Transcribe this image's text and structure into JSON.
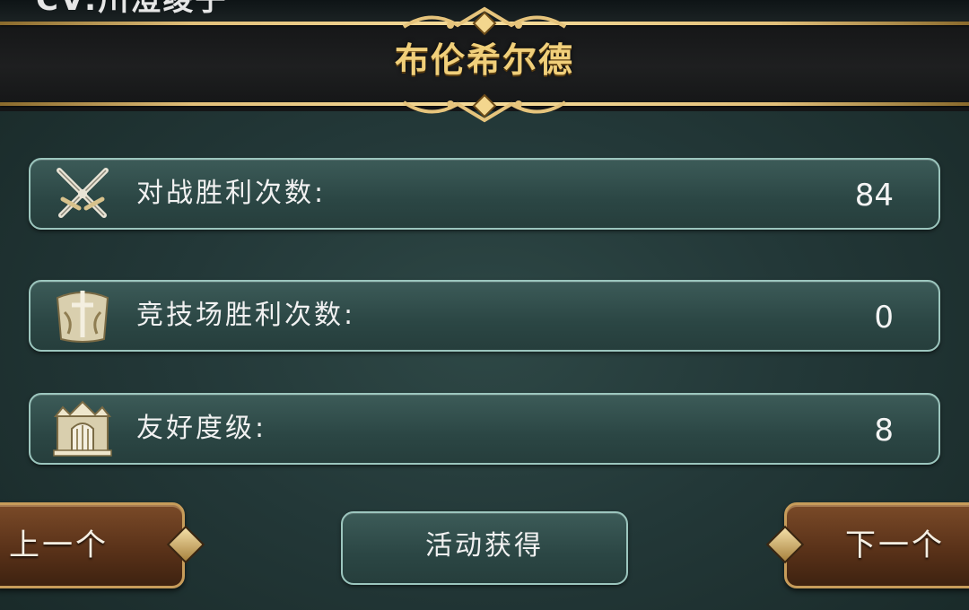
{
  "header": {
    "top_text": "CV:川澄绫子",
    "title": "布伦希尔德"
  },
  "stats": [
    {
      "label": "对战胜利次数:",
      "value": "84",
      "icon": "crossed-swords-icon"
    },
    {
      "label": "竞技场胜利次数:",
      "value": "0",
      "icon": "arena-emblem-icon"
    },
    {
      "label": "友好度级:",
      "value": "8",
      "icon": "castle-gate-icon"
    }
  ],
  "buttons": {
    "prev_label": "上一个",
    "center_label": "活动获得",
    "next_label": "下一个"
  },
  "colors": {
    "accent_gold": "#f0cf7a",
    "panel_border": "#9cc6be",
    "nav_brown": "#5a3219"
  }
}
